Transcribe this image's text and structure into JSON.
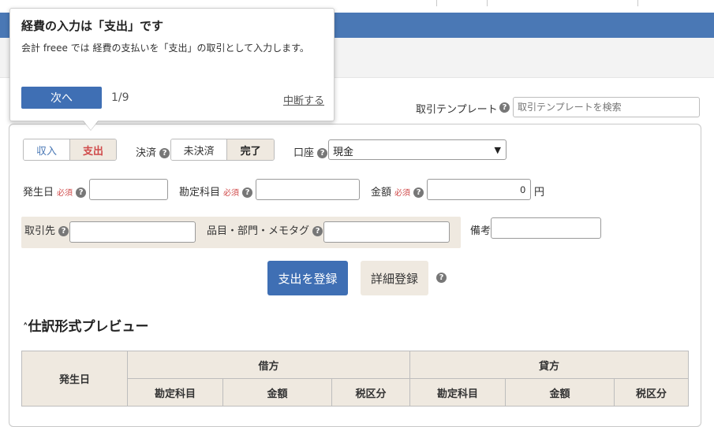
{
  "tooltip": {
    "title": "経費の入力は「支出」です",
    "body": "会計 freee では 経費の支払いを「支出」の取引として入力します。",
    "next_button": "次へ",
    "page": "1/9",
    "abort_link": "中断する"
  },
  "template": {
    "label": "取引テンプレート",
    "placeholder": "取引テンプレートを検索"
  },
  "form": {
    "type_toggle": {
      "income": "収入",
      "expense": "支出",
      "selected": "支出"
    },
    "settlement": {
      "label": "決済",
      "unsettled": "未決済",
      "done": "完了",
      "selected": "完了"
    },
    "account": {
      "label": "口座",
      "value": "現金"
    },
    "date": {
      "label": "発生日",
      "required": "必須",
      "value": ""
    },
    "account_item": {
      "label": "勘定科目",
      "required": "必須",
      "value": ""
    },
    "amount": {
      "label": "金額",
      "required": "必須",
      "value": "0",
      "unit": "円"
    },
    "partner": {
      "label": "取引先",
      "value": ""
    },
    "item_tags": {
      "label": "品目・部門・メモタグ",
      "value": ""
    },
    "memo": {
      "label": "備考",
      "value": ""
    },
    "register_button": "支出を登録",
    "detail_button": "詳細登録"
  },
  "preview": {
    "title": "仕訳形式プレビュー",
    "header": {
      "date": "発生日",
      "debit": "借方",
      "credit": "貸方",
      "account": "勘定科目",
      "amount": "金額",
      "tax": "税区分"
    }
  },
  "colors": {
    "brand_blue": "#4a78b5",
    "button_blue": "#3f6fb4",
    "accent_red": "#d04a4a",
    "beige": "#efe9e0"
  }
}
